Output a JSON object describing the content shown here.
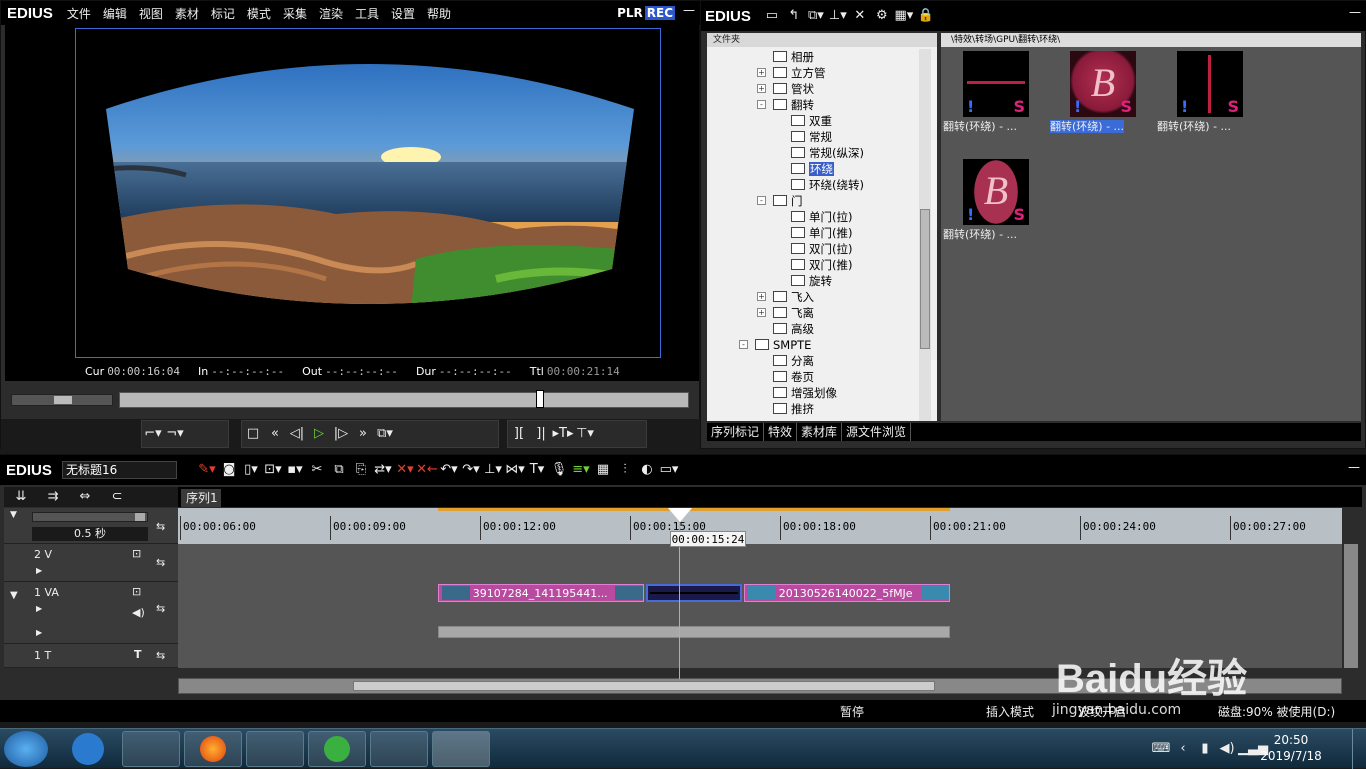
{
  "player": {
    "brand": "EDIUS",
    "menu": [
      "文件",
      "编辑",
      "视图",
      "素材",
      "标记",
      "模式",
      "采集",
      "渲染",
      "工具",
      "设置",
      "帮助"
    ],
    "mode_plr": "PLR",
    "mode_rec": "REC",
    "cur_label": "Cur",
    "cur_value": "00:00:16:04",
    "in_label": "In",
    "in_value": "--:--:--:--",
    "out_label": "Out",
    "out_value": "--:--:--:--",
    "dur_label": "Dur",
    "dur_value": "--:--:--:--",
    "ttl_label": "Ttl",
    "ttl_value": "00:00:21:14"
  },
  "bin": {
    "brand": "EDIUS",
    "tree_header": "文件夹",
    "path": "\\特效\\转场\\GPU\\翻转\\环绕\\",
    "tree": [
      {
        "label": "相册",
        "indent": 2,
        "exp": ""
      },
      {
        "label": "立方管",
        "indent": 2,
        "exp": "+"
      },
      {
        "label": "管状",
        "indent": 2,
        "exp": "+"
      },
      {
        "label": "翻转",
        "indent": 2,
        "exp": "-"
      },
      {
        "label": "双重",
        "indent": 3,
        "exp": ""
      },
      {
        "label": "常规",
        "indent": 3,
        "exp": ""
      },
      {
        "label": "常规(纵深)",
        "indent": 3,
        "exp": ""
      },
      {
        "label": "环绕",
        "indent": 3,
        "exp": "",
        "selected": true
      },
      {
        "label": "环绕(绕转)",
        "indent": 3,
        "exp": ""
      },
      {
        "label": "门",
        "indent": 2,
        "exp": "-"
      },
      {
        "label": "单门(拉)",
        "indent": 3,
        "exp": ""
      },
      {
        "label": "单门(推)",
        "indent": 3,
        "exp": ""
      },
      {
        "label": "双门(拉)",
        "indent": 3,
        "exp": ""
      },
      {
        "label": "双门(推)",
        "indent": 3,
        "exp": ""
      },
      {
        "label": "旋转",
        "indent": 3,
        "exp": ""
      },
      {
        "label": "飞入",
        "indent": 2,
        "exp": "+"
      },
      {
        "label": "飞离",
        "indent": 2,
        "exp": "+"
      },
      {
        "label": "高级",
        "indent": 2,
        "exp": ""
      },
      {
        "label": "SMPTE",
        "indent": 1,
        "exp": "-"
      },
      {
        "label": "分离",
        "indent": 2,
        "exp": ""
      },
      {
        "label": "卷页",
        "indent": 2,
        "exp": ""
      },
      {
        "label": "增强划像",
        "indent": 2,
        "exp": ""
      },
      {
        "label": "推挤",
        "indent": 2,
        "exp": ""
      }
    ],
    "clips": [
      {
        "caption": "翻转(环绕) - ...",
        "kind": "line"
      },
      {
        "caption": "翻转(环绕) - ...",
        "kind": "B",
        "selected": true
      },
      {
        "caption": "翻转(环绕) - ...",
        "kind": "vline"
      },
      {
        "caption": "翻转(环绕) - ...",
        "kind": "B2"
      }
    ],
    "thumb_letter": "B",
    "thumb_marker": "!",
    "thumb_s": "S",
    "tabs": [
      "序列标记",
      "特效",
      "素材库",
      "源文件浏览"
    ]
  },
  "timeline": {
    "brand": "EDIUS",
    "project_name": "无标题16",
    "sequence_tab": "序列1",
    "zoom": "0.5 秒",
    "ruler": [
      "00:00:06:00",
      "00:00:09:00",
      "00:00:12:00",
      "00:00:15:00",
      "00:00:18:00",
      "00:00:21:00",
      "00:00:24:00",
      "00:00:27:00"
    ],
    "playhead_tc": "00:00:15:24",
    "tracks": {
      "v2": "2 V",
      "va1": "1 VA",
      "t1": "1 T"
    },
    "clip_a": "39107284_141195441...",
    "clip_b": "20130526140022_5fMJe",
    "status": {
      "pause": "暂停",
      "insert": "插入模式",
      "ripple": "波纹开启",
      "disk": "磁盘:90% 被使用(D:)"
    }
  },
  "taskbar": {
    "time": "20:50",
    "date": "2019/7/18"
  },
  "watermark": {
    "text": "Baidu经验",
    "url": "jingyan.baidu.com"
  }
}
